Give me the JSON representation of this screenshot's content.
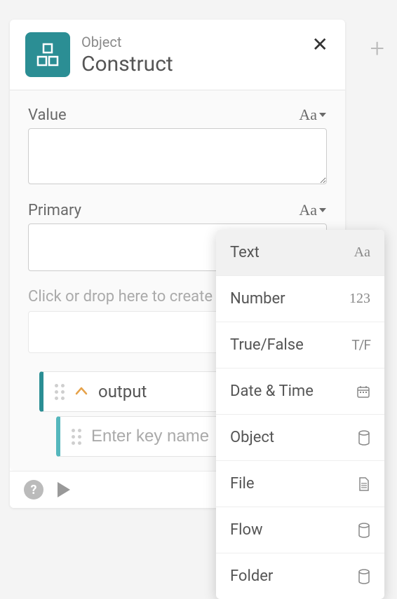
{
  "header": {
    "type_label": "Object",
    "title": "Construct"
  },
  "fields": {
    "value": {
      "label": "Value",
      "type_glyph": "Aa",
      "content": ""
    },
    "primary": {
      "label": "Primary",
      "type_glyph": "Aa",
      "content": ""
    }
  },
  "drop_hint": "Click or drop here to create",
  "output": {
    "label": "output",
    "key_placeholder": "Enter key name"
  },
  "dropdown": {
    "items": [
      {
        "label": "Text",
        "icon_text": "Aa",
        "icon_kind": "text",
        "selected": true
      },
      {
        "label": "Number",
        "icon_text": "123",
        "icon_kind": "text",
        "selected": false
      },
      {
        "label": "True/False",
        "icon_text": "T/F",
        "icon_kind": "tf",
        "selected": false
      },
      {
        "label": "Date & Time",
        "icon_text": "",
        "icon_kind": "calendar",
        "selected": false
      },
      {
        "label": "Object",
        "icon_text": "",
        "icon_kind": "cylinder",
        "selected": false
      },
      {
        "label": "File",
        "icon_text": "",
        "icon_kind": "file",
        "selected": false
      },
      {
        "label": "Flow",
        "icon_text": "",
        "icon_kind": "cylinder",
        "selected": false
      },
      {
        "label": "Folder",
        "icon_text": "",
        "icon_kind": "cylinder",
        "selected": false
      }
    ]
  },
  "icons": {
    "plus": "+",
    "close": "✕"
  }
}
